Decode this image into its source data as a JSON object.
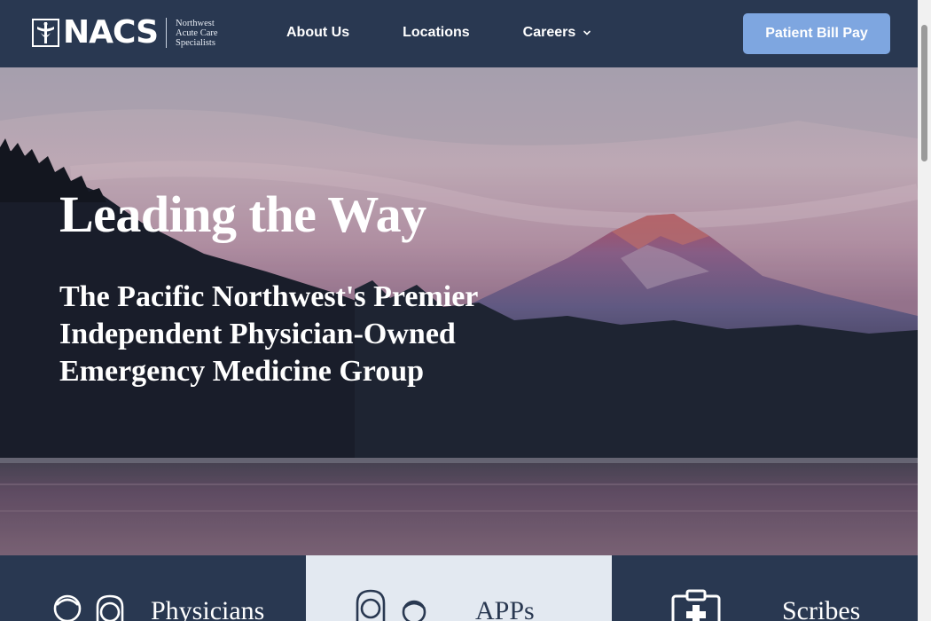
{
  "header": {
    "logo_text": "NACS",
    "logo_sub": [
      "Northwest",
      "Acute Care",
      "Specialists"
    ],
    "nav": [
      {
        "label": "About Us",
        "has_dropdown": false
      },
      {
        "label": "Locations",
        "has_dropdown": false
      },
      {
        "label": "Careers",
        "has_dropdown": true
      }
    ],
    "cta_label": "Patient Bill Pay"
  },
  "hero": {
    "title": "Leading the Way",
    "subtitle": "The Pacific Northwest's Premier Independent Physician-Owned Emergency Medicine Group"
  },
  "cards": [
    {
      "label": "Physicians",
      "icon": "physicians-icon",
      "theme": "dark"
    },
    {
      "label": "APPs",
      "icon": "apps-icon",
      "theme": "light"
    },
    {
      "label": "Scribes",
      "icon": "scribes-icon",
      "theme": "dark"
    }
  ],
  "colors": {
    "header_bg": "#293851",
    "cta_bg": "#7ea6e0",
    "card_light_bg": "#e3e9f1"
  }
}
